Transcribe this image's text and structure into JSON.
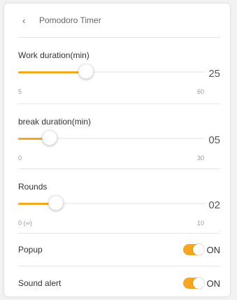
{
  "header": {
    "back_glyph": "‹",
    "title": "Pomodoro Timer"
  },
  "sliders": [
    {
      "label": "Work duration(min)",
      "value_text": "25",
      "min_text": "5",
      "max_text": "60",
      "min": 5,
      "max": 60,
      "value": 25
    },
    {
      "label": "break duration(min)",
      "value_text": "05",
      "min_text": "0",
      "max_text": "30",
      "min": 0,
      "max": 30,
      "value": 5
    },
    {
      "label": "Rounds",
      "value_text": "02",
      "min_text": "0 (∞)",
      "max_text": "10",
      "min": 0,
      "max": 10,
      "value": 2
    }
  ],
  "toggles": [
    {
      "label": "Popup",
      "state_text": "ON",
      "on": true
    },
    {
      "label": "Sound alert",
      "state_text": "ON",
      "on": true
    }
  ],
  "colors": {
    "accent": "#f5a623",
    "track": "#f0f0f0"
  }
}
